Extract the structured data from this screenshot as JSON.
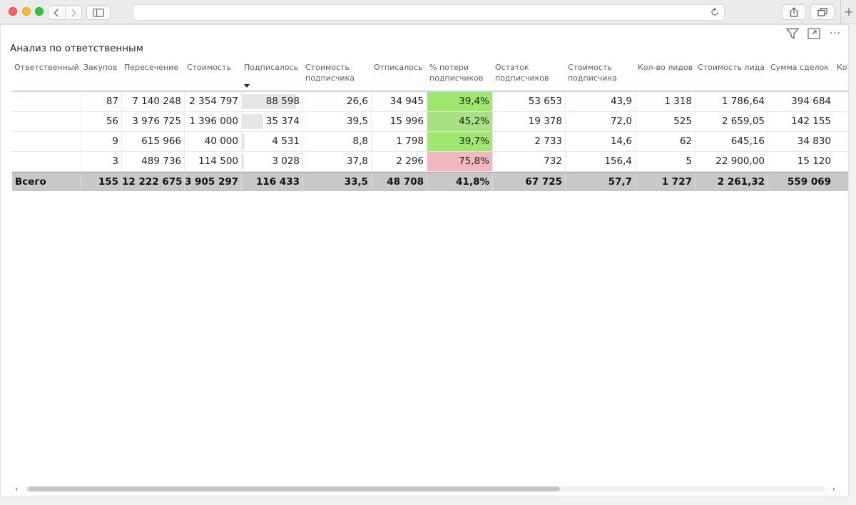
{
  "browser": {
    "url": "",
    "new_tab_label": "+"
  },
  "report": {
    "title": "Анализ по ответственным",
    "toolbar_icons": [
      "filter-icon",
      "focus-mode-icon",
      "more-options-icon"
    ],
    "more_label": "···"
  },
  "table": {
    "columns": [
      {
        "label": "Ответственный"
      },
      {
        "label": "Закупов"
      },
      {
        "label": "Пересечение"
      },
      {
        "label": "Стоимость"
      },
      {
        "label": "Подписалось",
        "sorted": "desc"
      },
      {
        "label": "Стоимость подписчика"
      },
      {
        "label": "Отписалось"
      },
      {
        "label": "% потери подписчиков"
      },
      {
        "label": "Остаток подписчиков"
      },
      {
        "label": "Стоимость подписчика"
      },
      {
        "label": "Кол-во лидов"
      },
      {
        "label": "Стоимость лида"
      },
      {
        "label": "Сумма сделок"
      },
      {
        "label": "Ко"
      }
    ],
    "rows": [
      {
        "owner": "",
        "cells": [
          "87",
          "7 140 248",
          "2 354 797",
          "88 598",
          "26,6",
          "34 945",
          "39,4%",
          "53 653",
          "43,9",
          "1 318",
          "1 786,64",
          "394 684"
        ],
        "subscribed_share": 1.0,
        "loss_color": "#9ee86d"
      },
      {
        "owner": "",
        "cells": [
          "56",
          "3 976 725",
          "1 396 000",
          "35 374",
          "39,5",
          "15 996",
          "45,2%",
          "19 378",
          "72,0",
          "525",
          "2 659,05",
          "142 155"
        ],
        "subscribed_share": 0.4,
        "loss_color": "#a8e082"
      },
      {
        "owner": "",
        "cells": [
          "9",
          "615 966",
          "40 000",
          "4 531",
          "8,8",
          "1 798",
          "39,7%",
          "2 733",
          "14,6",
          "62",
          "645,16",
          "34 830"
        ],
        "subscribed_share": 0.05,
        "loss_color": "#9ee86d"
      },
      {
        "owner": "",
        "cells": [
          "3",
          "489 736",
          "114 500",
          "3 028",
          "37,8",
          "2 296",
          "75,8%",
          "732",
          "156,4",
          "5",
          "22 900,00",
          "15 120"
        ],
        "subscribed_share": 0.034,
        "loss_color": "#f2b8be"
      }
    ],
    "total": {
      "label": "Всего",
      "cells": [
        "155",
        "12 222 675",
        "3 905 297",
        "116 433",
        "33,5",
        "48 708",
        "41,8%",
        "67 725",
        "57,7",
        "1 727",
        "2 261,32",
        "559 069"
      ]
    }
  },
  "scrollbar": {
    "left_arrow": "‹",
    "right_arrow": "›",
    "position": 0.0,
    "visible_fraction": 0.66
  }
}
